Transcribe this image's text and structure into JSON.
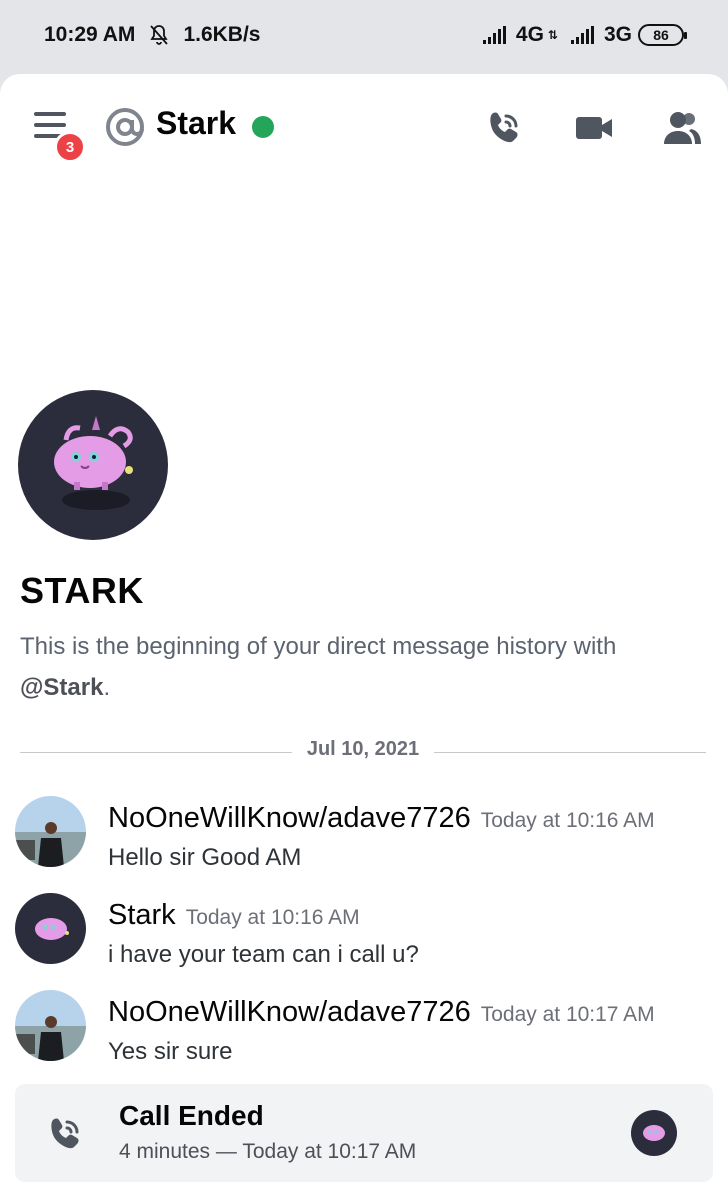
{
  "status_bar": {
    "time": "10:29 AM",
    "speed": "1.6KB/s",
    "net1": "4G",
    "net2": "3G",
    "battery": "86"
  },
  "header": {
    "unread_badge": "3",
    "channel_prefix": "@",
    "title": "Stark",
    "online_color": "#23a55a"
  },
  "welcome": {
    "name": "STARK",
    "text_before": "This is the beginning of your direct message history with ",
    "mention": "@Stark",
    "text_after": "."
  },
  "divider": {
    "date": "Jul 10, 2021"
  },
  "messages": [
    {
      "author": "NoOneWillKnow/adave7726",
      "time": "Today at 10:16 AM",
      "content": "Hello sir Good AM",
      "avatar": "user-photo"
    },
    {
      "author": "Stark",
      "time": "Today at 10:16 AM",
      "content": "i have your team can i call u?",
      "avatar": "pink-creature"
    },
    {
      "author": "NoOneWillKnow/adave7726",
      "time": "Today at 10:17 AM",
      "content": "Yes sir sure",
      "avatar": "user-photo"
    }
  ],
  "call": {
    "title": "Call Ended",
    "subtitle": "4 minutes — Today at 10:17 AM"
  },
  "colors": {
    "accent_red": "#ed4245",
    "online_green": "#23a55a",
    "icon_gray": "#4f5660"
  }
}
